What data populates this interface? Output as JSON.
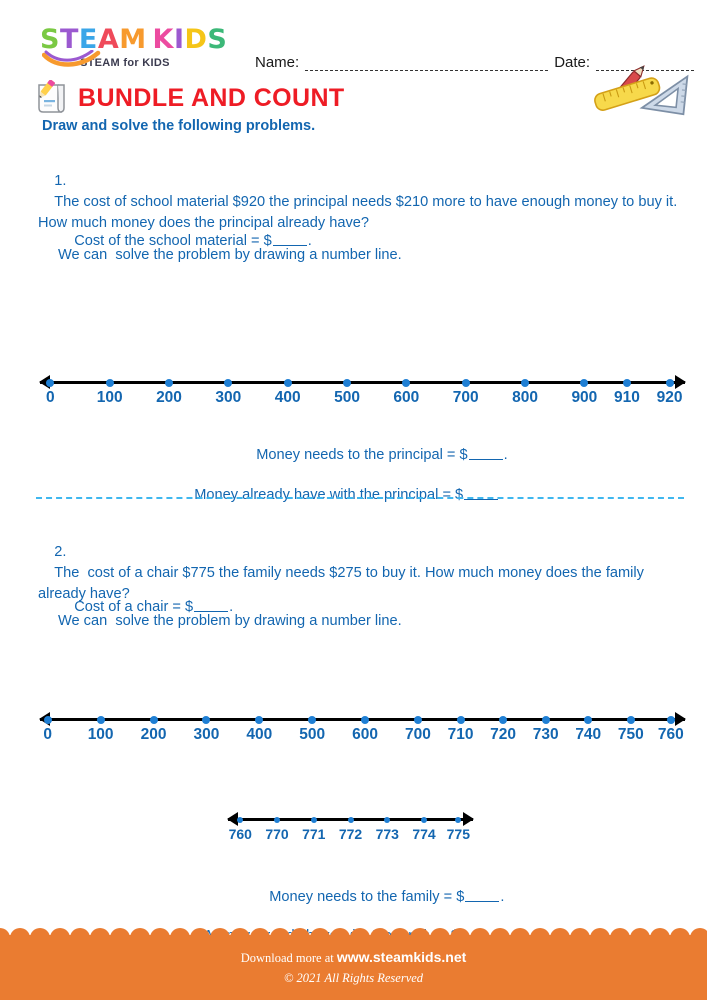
{
  "branding": {
    "logo_letters": [
      {
        "ch": "S",
        "color": "#7ac943"
      },
      {
        "ch": "T",
        "color": "#9b59d0"
      },
      {
        "ch": "E",
        "color": "#3aa6e8"
      },
      {
        "ch": "A",
        "color": "#ef4a5a"
      },
      {
        "ch": "M",
        "color": "#f79a2e"
      },
      {
        "ch": " ",
        "color": "#ffffff"
      },
      {
        "ch": "K",
        "color": "#ec4ba0"
      },
      {
        "ch": "I",
        "color": "#9b59d0"
      },
      {
        "ch": "D",
        "color": "#f5c518"
      },
      {
        "ch": "S",
        "color": "#3cb878"
      }
    ],
    "logo_tagline": "STEAM for KIDS"
  },
  "header": {
    "name_label": "Name:",
    "date_label": "Date:"
  },
  "title": {
    "heading": "BUNDLE AND COUNT",
    "subtitle": "Draw and solve the following problems.",
    "heading_color": "#ee1c25",
    "subtitle_color": "#1366b0"
  },
  "problems": [
    {
      "number": "1.",
      "statement": "The cost of school material $920 the principal needs $210 more to have enough money to buy it. How much money does the principal already have?",
      "cost_line_prefix": "Cost of the school material = $",
      "cost_line_suffix": ".",
      "method_line": "We can  solve the problem by drawing a number line.",
      "answer_lines": [
        {
          "prefix": "Money needs to the principal = $",
          "suffix": "."
        },
        {
          "prefix": "Money already have with the principal = $",
          "suffix": "."
        }
      ]
    },
    {
      "number": "2.",
      "statement": "The  cost of a chair $775 the family needs $275 to buy it. How much money does the family already have?",
      "cost_line_prefix": "Cost of a chair = $",
      "cost_line_suffix": ".",
      "method_line": "We can  solve the problem by drawing a number line.",
      "answer_lines": [
        {
          "prefix": "Money needs to the family = $",
          "suffix": "."
        },
        {
          "prefix": "Money already have with the family = $",
          "suffix": "."
        }
      ]
    }
  ],
  "chart_data": [
    {
      "type": "number-line",
      "id": "number-line-1",
      "labels": [
        "0",
        "100",
        "200",
        "300",
        "400",
        "500",
        "600",
        "700",
        "800",
        "900",
        "910",
        "920"
      ],
      "positions_pct": [
        1.6,
        10.8,
        20.0,
        29.2,
        38.4,
        47.6,
        56.8,
        66.0,
        75.2,
        84.4,
        91.0,
        97.6
      ],
      "arrow_left": true,
      "arrow_right": true,
      "tick_color": "#1f7fd4",
      "label_color": "#1366b0",
      "axis_color": "#000000"
    },
    {
      "type": "number-line",
      "id": "number-line-2",
      "labels": [
        "0",
        "100",
        "200",
        "300",
        "400",
        "500",
        "600",
        "700",
        "710",
        "720",
        "730",
        "740",
        "750",
        "760"
      ],
      "positions_pct": [
        1.2,
        9.4,
        17.6,
        25.8,
        34.0,
        42.2,
        50.4,
        58.6,
        65.2,
        71.8,
        78.4,
        85.0,
        91.6,
        97.8
      ],
      "arrow_left": true,
      "arrow_right": true,
      "tick_color": "#1f7fd4",
      "label_color": "#1366b0",
      "axis_color": "#000000"
    },
    {
      "type": "number-line",
      "id": "number-line-3",
      "labels": [
        "760",
        "770",
        "771",
        "772",
        "773",
        "774",
        "775"
      ],
      "positions_pct": [
        5.0,
        20.0,
        35.0,
        50.0,
        65.0,
        80.0,
        94.0
      ],
      "arrow_left": true,
      "arrow_right": true,
      "tick_color": "#1f7fd4",
      "label_color": "#1366b0",
      "axis_color": "#000000"
    }
  ],
  "footer": {
    "download_prefix": "Download more at ",
    "site": "www.steamkids.net",
    "copyright": "© 2021 All Rights Reserved",
    "background": "#ea7c31"
  }
}
